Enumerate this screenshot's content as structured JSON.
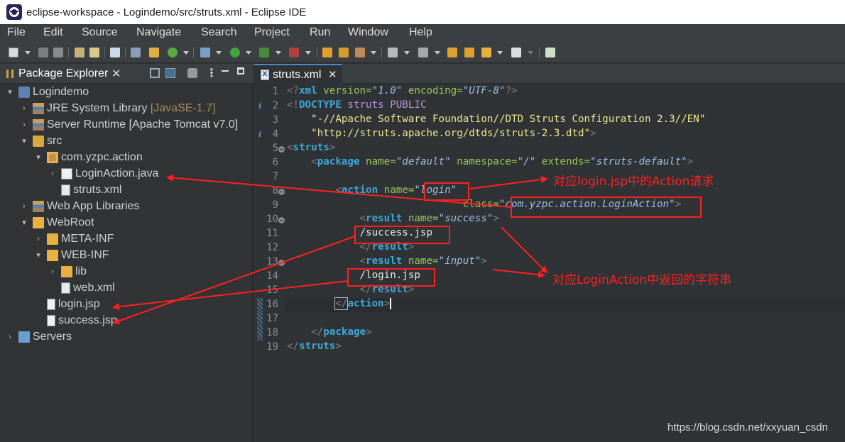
{
  "window": {
    "title": "eclipse-workspace - Logindemo/src/struts.xml - Eclipse IDE"
  },
  "menu": [
    "File",
    "Edit",
    "Source",
    "Navigate",
    "Search",
    "Project",
    "Run",
    "Window",
    "Help"
  ],
  "explorer": {
    "tab_label": "Package Explorer",
    "tab_close": "✕",
    "tree": [
      {
        "label": "Logindemo",
        "suffix": "",
        "chevron": "▾",
        "icon": "project-icon"
      },
      {
        "label": "JRE System Library",
        "suffix": "[JavaSE-1.7]",
        "chevron": "›",
        "icon": "library-icon"
      },
      {
        "label": "Server Runtime [Apache Tomcat v7.0]",
        "suffix": "",
        "chevron": "›",
        "icon": "library-icon"
      },
      {
        "label": "src",
        "suffix": "",
        "chevron": "▾",
        "icon": "source-folder-icon"
      },
      {
        "label": "com.yzpc.action",
        "suffix": "",
        "chevron": "▾",
        "icon": "package-icon"
      },
      {
        "label": "LoginAction.java",
        "suffix": "",
        "chevron": "›",
        "icon": "java-file-icon"
      },
      {
        "label": "struts.xml",
        "suffix": "",
        "chevron": "",
        "icon": "xml-file-icon"
      },
      {
        "label": "Web App Libraries",
        "suffix": "",
        "chevron": "›",
        "icon": "library-icon"
      },
      {
        "label": "WebRoot",
        "suffix": "",
        "chevron": "▾",
        "icon": "folder-icon"
      },
      {
        "label": "META-INF",
        "suffix": "",
        "chevron": "›",
        "icon": "folder-icon"
      },
      {
        "label": "WEB-INF",
        "suffix": "",
        "chevron": "▾",
        "icon": "folder-icon"
      },
      {
        "label": "lib",
        "suffix": "",
        "chevron": "›",
        "icon": "folder-icon"
      },
      {
        "label": "web.xml",
        "suffix": "",
        "chevron": "",
        "icon": "xml-file-icon"
      },
      {
        "label": "login.jsp",
        "suffix": "",
        "chevron": "",
        "icon": "jsp-file-icon"
      },
      {
        "label": "success.jsp",
        "suffix": "",
        "chevron": "",
        "icon": "jsp-file-icon"
      },
      {
        "label": "Servers",
        "suffix": "",
        "chevron": "›",
        "icon": "servers-icon"
      }
    ]
  },
  "editor": {
    "tab_label": "struts.xml",
    "tab_close": "✕",
    "tab_icon_text": "X",
    "line_numbers": [
      "1",
      "2",
      "3",
      "4",
      "5",
      "6",
      "7",
      "8",
      "9",
      "10",
      "11",
      "12",
      "13",
      "14",
      "15",
      "16",
      "17",
      "18",
      "19"
    ],
    "info_marker": "i",
    "lines": {
      "l1": {
        "p1": "<?",
        "t": "xml",
        "a1": " version=",
        "v1": "\"1.0\"",
        "a2": " encoding=",
        "v2": "\"UTF-8\"",
        "p2": "?>"
      },
      "l2": {
        "p1": "<!",
        "t": "DOCTYPE",
        "d": " struts PUBLIC"
      },
      "l3": {
        "s": "    \"-//Apache Software Foundation//DTD Struts Configuration 2.3//EN\""
      },
      "l4": {
        "s": "    \"http://struts.apache.org/dtds/struts-2.3.dtd\"",
        "p": ">"
      },
      "l5": {
        "p1": "<",
        "t": "struts",
        "p2": ">"
      },
      "l6": {
        "ind": "    ",
        "p1": "<",
        "t": "package",
        "a1": " name=",
        "v1": "\"default\"",
        "a2": " namespace=",
        "v2": "\"/\"",
        "a3": " extends=",
        "v3": "\"struts-default\"",
        "p2": ">"
      },
      "l8": {
        "ind": "        ",
        "p1": "<",
        "t": "action",
        "a1": " name=",
        "v1": "\"login\""
      },
      "l9": {
        "ind": "                             ",
        "a1": "class=",
        "v1": "\"com.yzpc.action.LoginAction\"",
        "p": ">"
      },
      "l10": {
        "ind": "            ",
        "p1": "<",
        "t": "result",
        "a1": " name=",
        "v1": "\"success\"",
        "p2": ">"
      },
      "l11": {
        "ind": "            ",
        "tx": "/success.jsp"
      },
      "l12": {
        "ind": "            ",
        "p1": "</",
        "t": "result",
        "p2": ">"
      },
      "l13": {
        "ind": "            ",
        "p1": "<",
        "t": "result",
        "a1": " name=",
        "v1": "\"input\"",
        "p2": ">"
      },
      "l14": {
        "ind": "            ",
        "tx": "/login.jsp"
      },
      "l15": {
        "ind": "            ",
        "p1": "</",
        "t": "result",
        "p2": ">"
      },
      "l16": {
        "ind": "        ",
        "p1": "</",
        "t": "action",
        "p2": ">"
      },
      "l18": {
        "ind": "    ",
        "p1": "</",
        "t": "package",
        "p2": ">"
      },
      "l19": {
        "p1": "</",
        "t": "struts",
        "p2": ">"
      }
    }
  },
  "annotations": {
    "note_action": "对应login.jsp中的Action请求",
    "note_result": "对应LoginAction中返回的字符串"
  },
  "watermark": "https://blog.csdn.net/xxyuan_csdn",
  "colors": {
    "annotation": "#ff2020",
    "tag": "#3da7d8",
    "attribute": "#9ac45a",
    "value": "#9cbeea",
    "string": "#f0e68c"
  }
}
